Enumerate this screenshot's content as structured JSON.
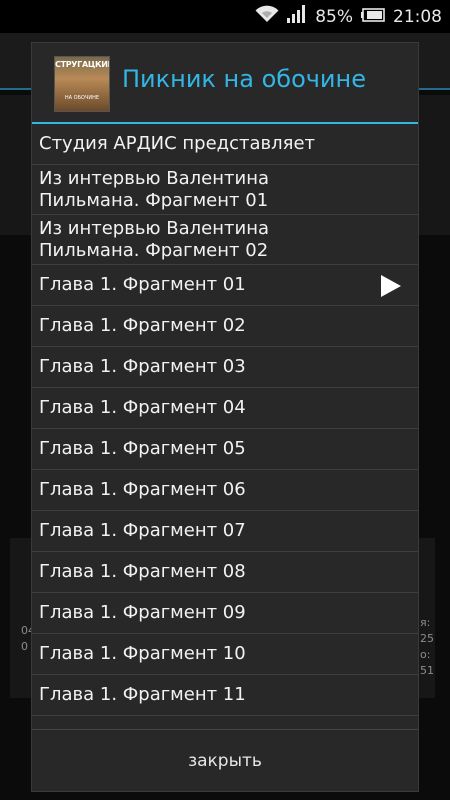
{
  "status_bar": {
    "battery_percent": "85%",
    "time": "21:08",
    "icons": [
      "wifi-icon",
      "signal-icon",
      "battery-icon"
    ]
  },
  "dialog": {
    "cover": {
      "author_text": "СТРУГАЦКИЕ",
      "subtitle_text": "НА ОБОЧИНЕ"
    },
    "title": "Пикник на обочине",
    "items": [
      {
        "label": "Студия АРДИС представляет",
        "playing": false
      },
      {
        "label": "Из интервью Валентина\nПильмана. Фрагмент 01",
        "playing": false
      },
      {
        "label": "Из интервью Валентина\nПильмана. Фрагмент 02",
        "playing": false
      },
      {
        "label": "Глава 1. Фрагмент 01",
        "playing": true
      },
      {
        "label": "Глава 1. Фрагмент 02",
        "playing": false
      },
      {
        "label": "Глава 1. Фрагмент 03",
        "playing": false
      },
      {
        "label": "Глава 1. Фрагмент 04",
        "playing": false
      },
      {
        "label": "Глава 1. Фрагмент 05",
        "playing": false
      },
      {
        "label": "Глава 1. Фрагмент 06",
        "playing": false
      },
      {
        "label": "Глава 1. Фрагмент 07",
        "playing": false
      },
      {
        "label": "Глава 1. Фрагмент 08",
        "playing": false
      },
      {
        "label": "Глава 1. Фрагмент 09",
        "playing": false
      },
      {
        "label": "Глава 1. Фрагмент 10",
        "playing": false
      },
      {
        "label": "Глава 1. Фрагмент 11",
        "playing": false
      }
    ],
    "close_label": "закрыть",
    "accent_color": "#33b5e5"
  },
  "background": {
    "left_fragment_1": "04",
    "left_fragment_2": "0",
    "right_fragment_1": "я:",
    "right_fragment_2": "25",
    "right_fragment_3": "о:",
    "right_fragment_4": "51"
  }
}
